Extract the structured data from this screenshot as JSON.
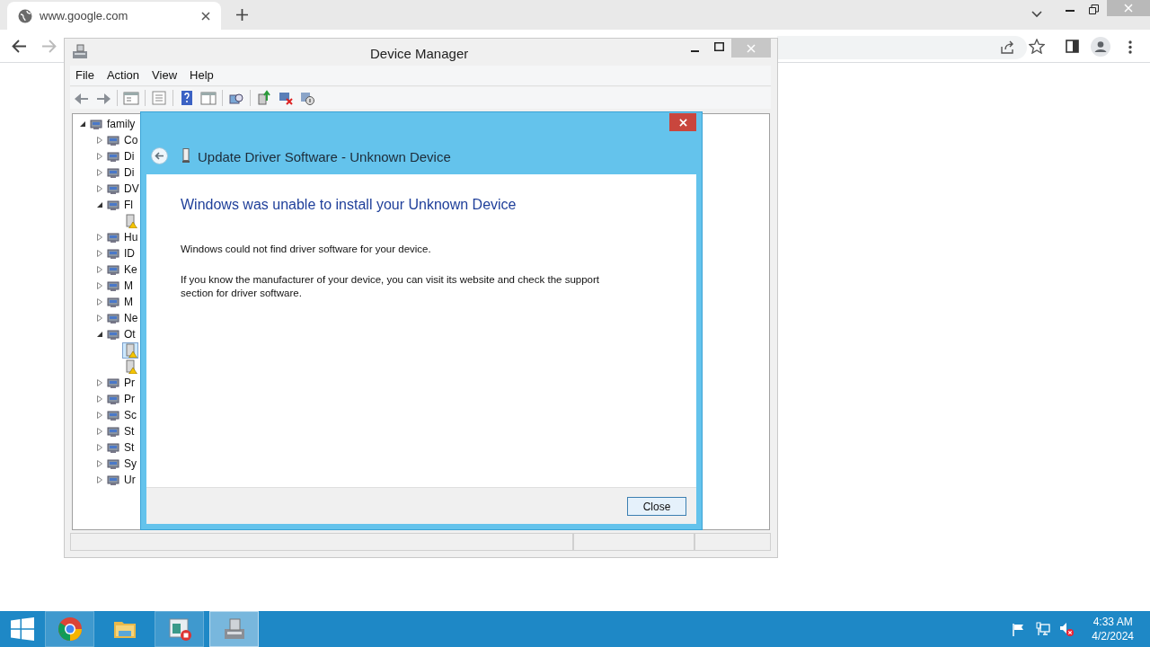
{
  "browser": {
    "tab_title": "www.google.com"
  },
  "window": {
    "title": "Device Manager",
    "menu": [
      "File",
      "Action",
      "View",
      "Help"
    ]
  },
  "tree": [
    {
      "label": "family",
      "expanded": true,
      "selected": false,
      "children": [
        {
          "label": "Co",
          "expanded": false,
          "selected": false
        },
        {
          "label": "Di",
          "expanded": false,
          "selected": false
        },
        {
          "label": "Di",
          "expanded": false,
          "selected": false
        },
        {
          "label": "DV",
          "expanded": false,
          "selected": false
        },
        {
          "label": "Fl",
          "expanded": true,
          "selected": false,
          "children": [
            {
              "warning": true,
              "selected": false
            }
          ]
        },
        {
          "label": "Hu",
          "expanded": false,
          "selected": false
        },
        {
          "label": "ID",
          "expanded": false,
          "selected": false
        },
        {
          "label": "Ke",
          "expanded": false,
          "selected": false
        },
        {
          "label": "M",
          "expanded": false,
          "selected": false
        },
        {
          "label": "M",
          "expanded": false,
          "selected": false
        },
        {
          "label": "Ne",
          "expanded": false,
          "selected": false
        },
        {
          "label": "Ot",
          "expanded": true,
          "selected": false,
          "children": [
            {
              "warning": true,
              "selected": true
            },
            {
              "warning": true,
              "selected": false
            }
          ]
        },
        {
          "label": "Pr",
          "expanded": false,
          "selected": false
        },
        {
          "label": "Pr",
          "expanded": false,
          "selected": false
        },
        {
          "label": "Sc",
          "expanded": false,
          "selected": false
        },
        {
          "label": "St",
          "expanded": false,
          "selected": false
        },
        {
          "label": "St",
          "expanded": false,
          "selected": false
        },
        {
          "label": "Sy",
          "expanded": false,
          "selected": false
        },
        {
          "label": "Ur",
          "expanded": false,
          "selected": false
        }
      ]
    }
  ],
  "dialog": {
    "title": "Update Driver Software - Unknown Device",
    "heading": "Windows was unable to install your Unknown Device",
    "paragraphs": [
      "Windows could not find driver software for your device.",
      "If you know the manufacturer of your device, you can visit its website and check the support section for driver software."
    ],
    "button": "Close"
  },
  "taskbar": [
    {
      "kind": "chrome",
      "selected": false
    },
    {
      "kind": "folder",
      "selected": false
    },
    {
      "kind": "recorder",
      "selected": false
    },
    {
      "kind": "devmgr",
      "selected": true
    }
  ],
  "clock": {
    "time": "4:33 AM",
    "date": "4/2/2024"
  }
}
